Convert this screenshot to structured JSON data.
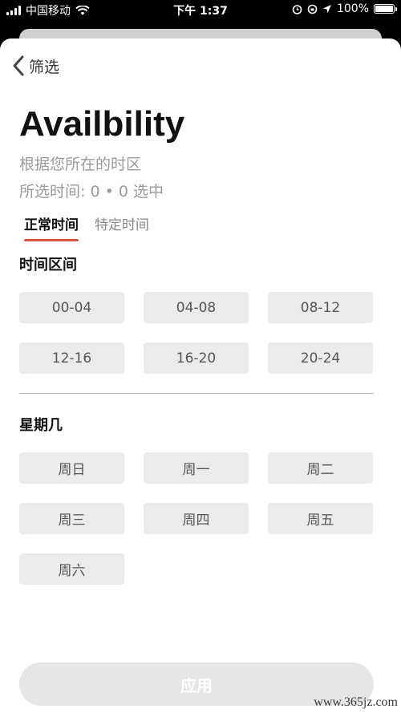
{
  "status_bar": {
    "carrier": "中国移动",
    "time": "下午 1:37",
    "battery": "100%",
    "battery_level": 1.0
  },
  "header": {
    "back_label": "筛选"
  },
  "page": {
    "title": "Availbility",
    "timezone_note": "根据您所在的时区",
    "selected_summary": "所选时间: 0 • 0 选中"
  },
  "tabs": [
    {
      "label": "正常时间",
      "active": true
    },
    {
      "label": "特定时间",
      "active": false
    }
  ],
  "time_section": {
    "title": "时间区间",
    "options": [
      "00-04",
      "04-08",
      "08-12",
      "12-16",
      "16-20",
      "20-24"
    ]
  },
  "weekday_section": {
    "title": "星期几",
    "options": [
      "周日",
      "周一",
      "周二",
      "周三",
      "周四",
      "周五",
      "周六"
    ]
  },
  "apply_button": {
    "label": "应用"
  },
  "watermark": "www.365jz.com",
  "colors": {
    "tab_underline": "#d35a3c",
    "chip_bg": "#ebebeb",
    "button_disabled": "#e6e6e6"
  }
}
